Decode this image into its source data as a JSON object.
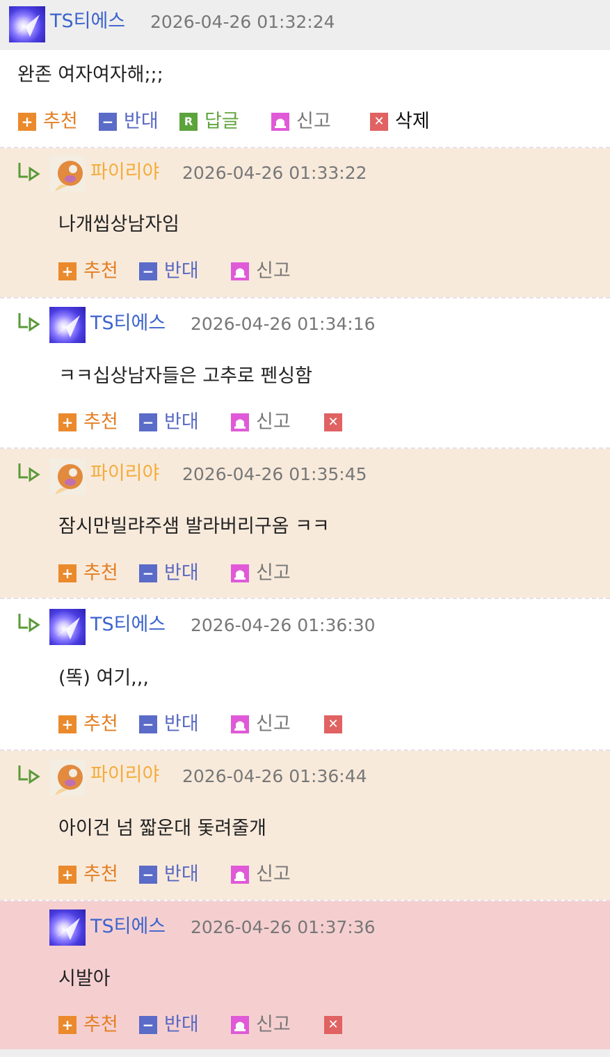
{
  "actions": {
    "upvote": "추천",
    "downvote": "반대",
    "reply": "답글",
    "report": "신고",
    "delete": "삭제"
  },
  "colors": {
    "beige_background": "#f8eadb",
    "pink_background": "#f5cfd0",
    "nick_blue": "#3b63cc",
    "nick_orange": "#f3ac3a",
    "upvote": "#ea8a2c",
    "downvote": "#5a6bc8",
    "reply": "#5ba33b",
    "delete": "#e06262"
  },
  "icons": {
    "upvote": "plus-icon",
    "downvote": "minus-icon",
    "reply": "reply-r-icon",
    "report": "siren-icon",
    "delete": "x-icon",
    "nested": "reply-arrow-icon"
  },
  "comments": [
    {
      "nick": "TS티에스",
      "date": "2026-04-26 01:32:24",
      "text": "완존 여자여자해;;;"
    },
    {
      "nick": "파이리야",
      "date": "2026-04-26 01:33:22",
      "text": "나개씹상남자임"
    },
    {
      "nick": "TS티에스",
      "date": "2026-04-26 01:34:16",
      "text": "ㅋㅋ십상남자들은 고추로 펜싱함"
    },
    {
      "nick": "파이리야",
      "date": "2026-04-26 01:35:45",
      "text": "잠시만빌랴주샘 발라버리구옴 ㅋㅋ"
    },
    {
      "nick": "TS티에스",
      "date": "2026-04-26 01:36:30",
      "text": "(똑) 여기,,,"
    },
    {
      "nick": "파이리야",
      "date": "2026-04-26 01:36:44",
      "text": "아이건 넘 짧운대 돛려줄개"
    },
    {
      "nick": "TS티에스",
      "date": "2026-04-26 01:37:36",
      "text": "시발아"
    }
  ]
}
